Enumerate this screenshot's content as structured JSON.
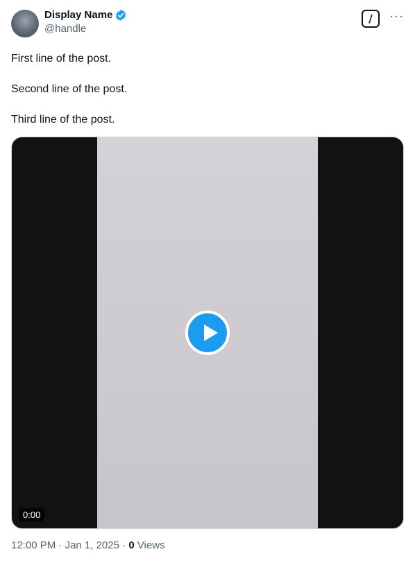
{
  "author": {
    "name": "Display Name",
    "handle": "@handle"
  },
  "post": {
    "lines": [
      "First line of the post.",
      "Second line of the post.",
      "Third line of the post."
    ]
  },
  "media": {
    "duration": "0:00"
  },
  "meta": {
    "time": "12:00 PM",
    "sep1": "·",
    "date": "Jan 1, 2025",
    "sep2": "·",
    "views": "0",
    "views_label": "Views"
  },
  "icons": {
    "verified": "verified-badge-icon",
    "grok": "grok-icon",
    "more": "more-icon",
    "play": "play-icon"
  },
  "colors": {
    "verified": "#1d9bf0",
    "text": "#0f1419",
    "secondary": "#536471"
  }
}
